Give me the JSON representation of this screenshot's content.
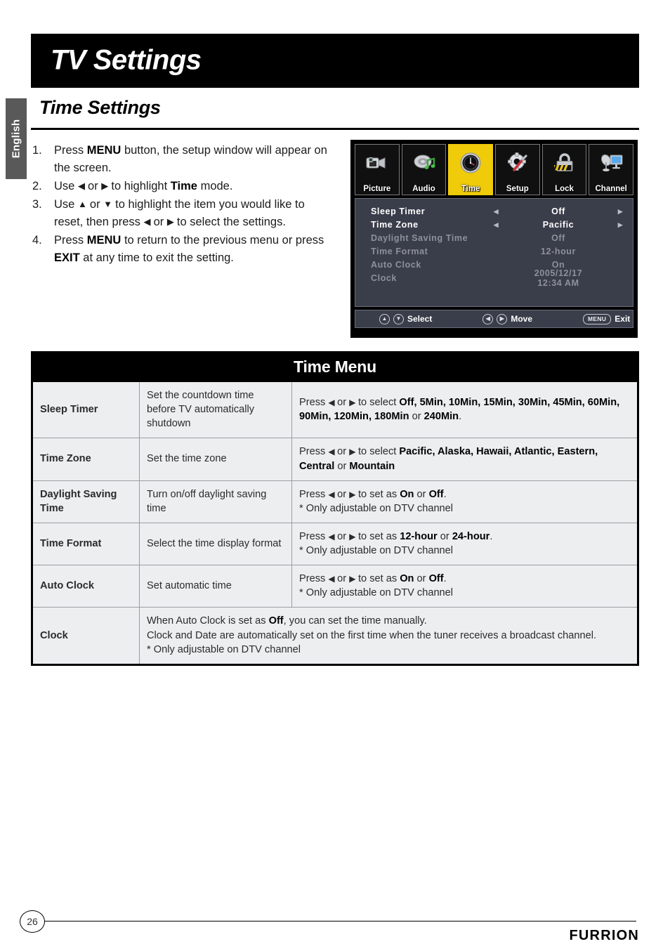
{
  "language_tab": "English",
  "header": {
    "title": "TV Settings"
  },
  "section": {
    "title": "Time Settings"
  },
  "steps": [
    {
      "num": "1.",
      "html": "Press <b>MENU</b> button, the setup window will appear on the screen."
    },
    {
      "num": "2.",
      "html": "Use <span class='gl'>◀</span> or <span class='gl'>▶</span> to highlight <b>Time</b> mode."
    },
    {
      "num": "3.",
      "html": "Use <span class='gl'>▲</span> or <span class='gl'>▼</span> to highlight the item you would like to reset, then press <span class='gl'>◀</span> or <span class='gl'>▶</span> to select the settings."
    },
    {
      "num": "4.",
      "html": "Press <b>MENU</b> to return to the previous menu or press <b>EXIT</b> at any time to exit the setting."
    }
  ],
  "osd": {
    "tabs": [
      {
        "label": "Picture",
        "icon": "camcorder-icon",
        "active": false
      },
      {
        "label": "Audio",
        "icon": "speaker-music-note-icon",
        "active": false
      },
      {
        "label": "Time",
        "icon": "clock-icon",
        "active": true
      },
      {
        "label": "Setup",
        "icon": "gear-screwdriver-icon",
        "active": false
      },
      {
        "label": "Lock",
        "icon": "padlock-icon",
        "active": false
      },
      {
        "label": "Channel",
        "icon": "satellite-dish-monitor-icon",
        "active": false
      }
    ],
    "highlight_color": "#EFCB0A",
    "panel_color": "#3A3D4A",
    "rows": [
      {
        "label": "Sleep Timer",
        "value": "Off",
        "arrows": true,
        "dim": false
      },
      {
        "label": "Time Zone",
        "value": "Pacific",
        "arrows": true,
        "dim": false
      },
      {
        "label": "Daylight Saving Time",
        "value": "Off",
        "arrows": false,
        "dim": true
      },
      {
        "label": "Time Format",
        "value": "12-hour",
        "arrows": false,
        "dim": true
      },
      {
        "label": "Auto Clock",
        "value": "On",
        "arrows": false,
        "dim": true
      },
      {
        "label": "Clock",
        "value": "2005/12/17 12:34 AM",
        "arrows": false,
        "dim": true
      }
    ],
    "footer": {
      "select_label": "Select",
      "move_label": "Move",
      "exit_label": "Exit",
      "menu_key": "MENU",
      "up_key": "▲",
      "down_key": "▼",
      "left_key": "◀",
      "right_key": "▶"
    }
  },
  "table": {
    "title": "Time Menu",
    "rows": [
      {
        "name": "Sleep Timer",
        "desc": "Set the countdown time before TV automatically shutdown",
        "action_html": "Press <span class='arrow-ico'>◀</span> or <span class='arrow-ico'>▶</span> to select <b>Off, 5Min, 10Min, 15Min, 30Min, 45Min, 60Min, 90Min, 120Min, 180Min</b> or <b>240Min</b>.",
        "note": ""
      },
      {
        "name": "Time Zone",
        "desc": "Set the time zone",
        "action_html": "Press <span class='arrow-ico'>◀</span> or <span class='arrow-ico'>▶</span> to select <b>Pacific, Alaska, Hawaii, Atlantic, Eastern, Central</b> or <b>Mountain</b>",
        "note": ""
      },
      {
        "name": "Daylight Saving Time",
        "desc": "Turn on/off daylight saving time",
        "action_html": "Press <span class='arrow-ico'>◀</span> or <span class='arrow-ico'>▶</span> to set as <b>On</b> or <b>Off</b>.",
        "note": "* Only adjustable on DTV channel"
      },
      {
        "name": "Time Format",
        "desc": "Select the time display format",
        "action_html": "Press <span class='arrow-ico'>◀</span> or <span class='arrow-ico'>▶</span> to set as <b>12-hour</b> or <b>24-hour</b>.",
        "note": "* Only adjustable on DTV channel"
      },
      {
        "name": "Auto Clock",
        "desc": "Set automatic time",
        "action_html": "Press <span class='arrow-ico'>◀</span> or <span class='arrow-ico'>▶</span> to set as <b>On</b> or <b>Off</b>.",
        "note": "* Only adjustable on DTV channel"
      },
      {
        "name": "Clock",
        "desc": null,
        "action_html": "When Auto Clock is set as <b>Off</b>, you can set the time manually.<br>Clock and Date are automatically set on the first time when the tuner receives a broadcast channel.",
        "note": "* Only adjustable on DTV channel"
      }
    ]
  },
  "footer": {
    "page_number": "26",
    "brand": "FURRION"
  }
}
